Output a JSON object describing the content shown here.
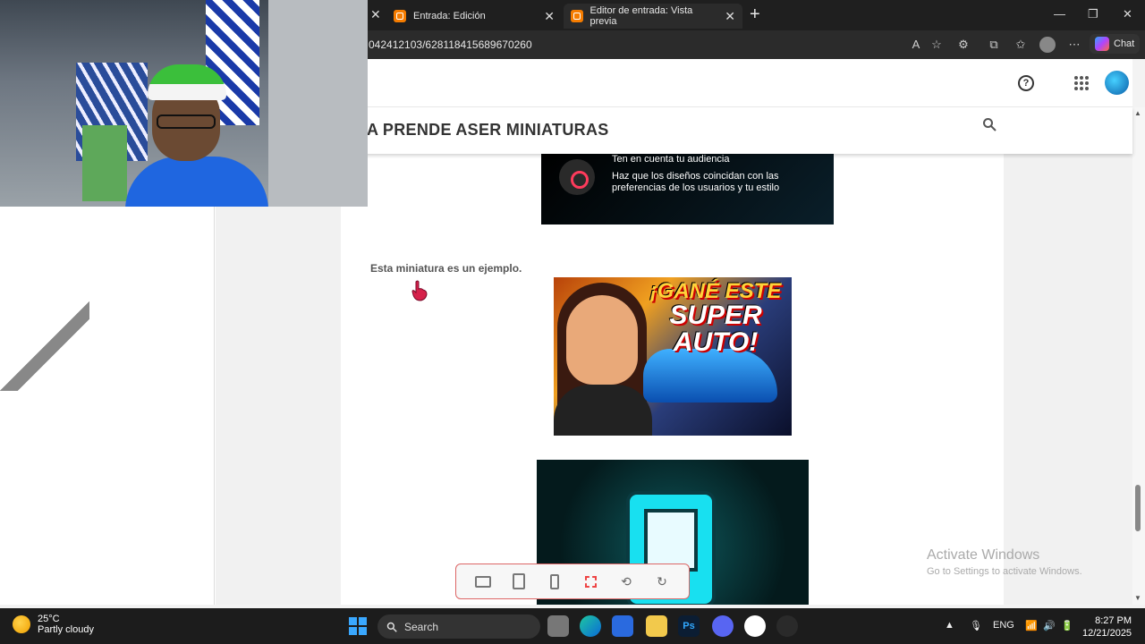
{
  "browser": {
    "tabs": [
      {
        "label": "Entrada: Edición"
      },
      {
        "label": "Editor de entrada: Vista previa"
      }
    ],
    "url": "042412103/628118415689670260",
    "chat_label": "Chat"
  },
  "blog": {
    "title": "A PRENDE ASER MINIATURAS",
    "help_symbol": "?"
  },
  "post": {
    "card_title": "Ten en cuenta tu audiencia",
    "card_body": "Haz que los diseños coincidan con las preferencias de los usuarios y tu estilo",
    "example_text": "Esta miniatura es un ejemplo.",
    "thumb_line1": "¡GANÉ ESTE",
    "thumb_line2": "SUPER AUTO!"
  },
  "watermark": {
    "line1": "Activate Windows",
    "line2": "Go to Settings to activate Windows."
  },
  "taskbar": {
    "temperature": "25°C",
    "weather": "Partly cloudy",
    "search_label": "Search",
    "lang": "ENG",
    "time": "8:27 PM",
    "date": "12/21/2025"
  },
  "colors": {
    "accent_orange": "#f57c00",
    "teal": "#18e0f0",
    "taskbar": "#1c1c1c"
  }
}
